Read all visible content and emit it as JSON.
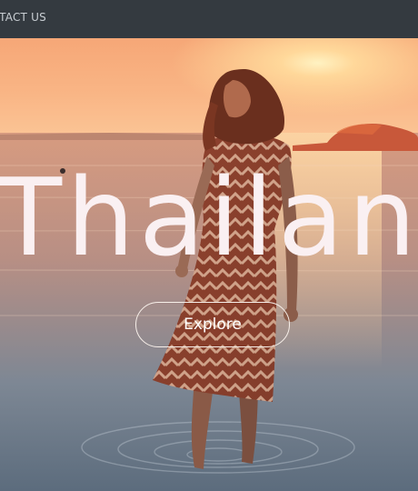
{
  "nav": {
    "contact_label": "NTACT US"
  },
  "hero": {
    "title": "Thailand",
    "button_label": "Explore"
  },
  "colors": {
    "navbar_bg": "#343a40",
    "nav_text": "#c9ced3",
    "title_text": "#faf0f2",
    "button_border": "#f7efe9"
  }
}
